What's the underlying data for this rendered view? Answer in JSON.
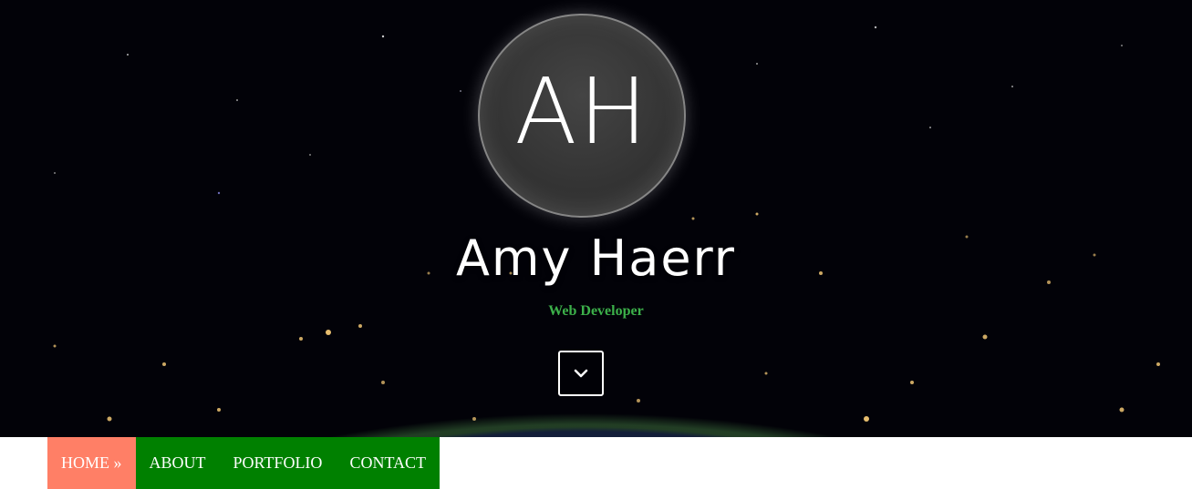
{
  "hero": {
    "logo_text": "AH",
    "name": "Amy Haerr",
    "tagline": "Web Developer",
    "scroll_icon": "chevron-down-icon"
  },
  "nav": {
    "items": [
      {
        "label": "HOME »",
        "active": true
      },
      {
        "label": "ABOUT",
        "active": false
      },
      {
        "label": "PORTFOLIO",
        "active": false
      },
      {
        "label": "CONTACT",
        "active": false
      }
    ]
  },
  "colors": {
    "nav_bg": "#008000",
    "nav_active": "#ff7f66",
    "tagline": "#3cb04a"
  }
}
